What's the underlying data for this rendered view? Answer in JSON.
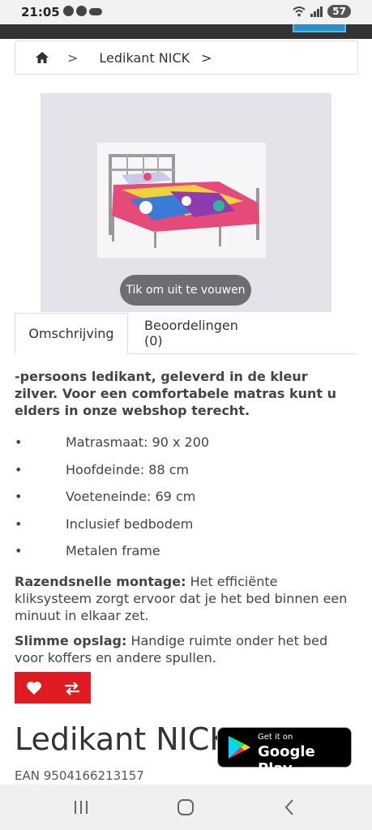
{
  "status": {
    "time": "21:05",
    "battery": "57"
  },
  "breadcrumb": {
    "separator": ">",
    "current": "Ledikant NICK",
    "trailing": ">"
  },
  "image": {
    "collapse_label": "Tik om uit te vouwen"
  },
  "tabs": [
    {
      "label": "Omschrijving"
    },
    {
      "label": "Beoordelingen (0)"
    }
  ],
  "description": {
    "intro": "-persoons ledikant, geleverd in de kleur zilver. Voor een comfortabele matras kunt u elders in onze webshop terecht.",
    "bullet_symbol": "•",
    "bullets": [
      "Matrasmaat: 90 x 200",
      "Hoofdeinde: 88 cm",
      "Voeteneinde: 69 cm",
      "Inclusief bedbodem",
      "Metalen frame"
    ],
    "para1_bold": "Razendsnelle montage:",
    "para1_text": " Het efficiënte kliksysteem zorgt ervoor dat je het bed binnen een minuut in elkaar zet.",
    "para2_bold": "Slimme opslag:",
    "para2_text": " Handige ruimte onder het bed voor koffers en andere spullen."
  },
  "actions": {
    "wishlist_icon": "heart-icon",
    "compare_icon": "compare-arrows-icon",
    "color": "#e11b22"
  },
  "product": {
    "title": "Ledikant NICK",
    "ean": "EAN 9504166213157"
  },
  "google_play": {
    "small": "Get it on",
    "big": "Google Play"
  }
}
